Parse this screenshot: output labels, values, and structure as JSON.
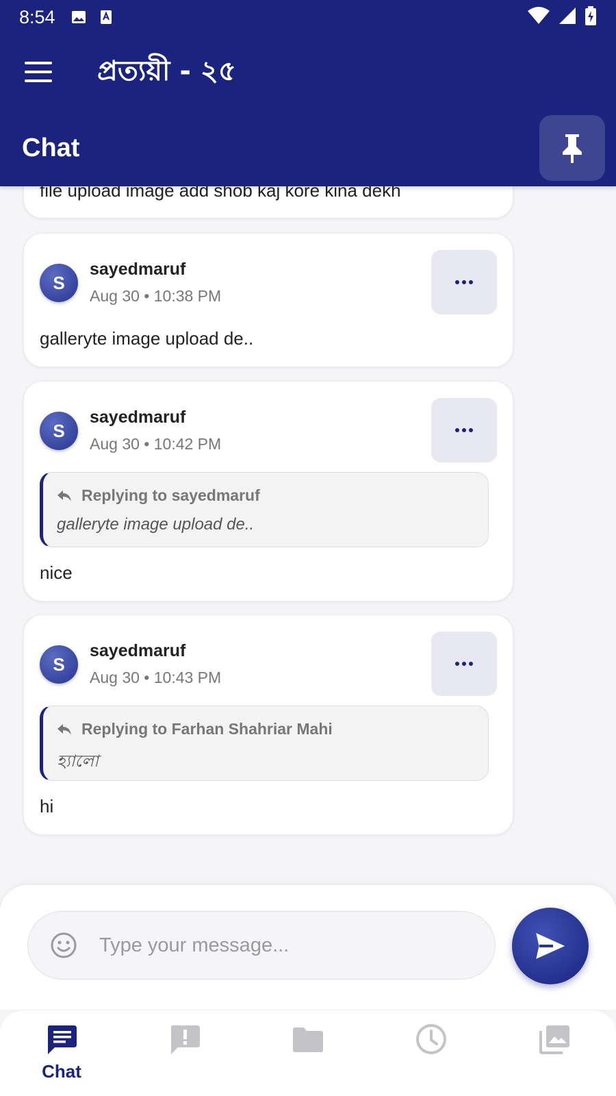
{
  "status_bar": {
    "time": "8:54"
  },
  "app_bar": {
    "title": "প্রত্যয়ী - ২৫"
  },
  "section": {
    "title": "Chat"
  },
  "partial_message": {
    "text": "file upload image add shob kaj kore kina dekh"
  },
  "messages": [
    {
      "avatar_letter": "S",
      "username": "sayedmaruf",
      "timestamp": "Aug 30 • 10:38 PM",
      "text": "galleryte image upload de.."
    },
    {
      "avatar_letter": "S",
      "username": "sayedmaruf",
      "timestamp": "Aug 30 • 10:42 PM",
      "reply_to": "Replying to sayedmaruf",
      "reply_quote": "galleryte image upload de..",
      "text": "nice"
    },
    {
      "avatar_letter": "S",
      "username": "sayedmaruf",
      "timestamp": "Aug 30 • 10:43 PM",
      "reply_to": "Replying to Farhan Shahriar Mahi",
      "reply_quote": "হ্যালো",
      "text": "hi"
    }
  ],
  "composer": {
    "placeholder": "Type your message..."
  },
  "bottom_nav": {
    "items": [
      {
        "label": "Chat",
        "icon": "chat-icon",
        "active": true
      },
      {
        "icon": "report-icon"
      },
      {
        "icon": "folder-icon"
      },
      {
        "icon": "clock-icon"
      },
      {
        "icon": "gallery-icon"
      }
    ]
  },
  "colors": {
    "primary": "#1a237e",
    "background": "#f5f5f7",
    "inactive_icon": "#c4c4c8"
  }
}
